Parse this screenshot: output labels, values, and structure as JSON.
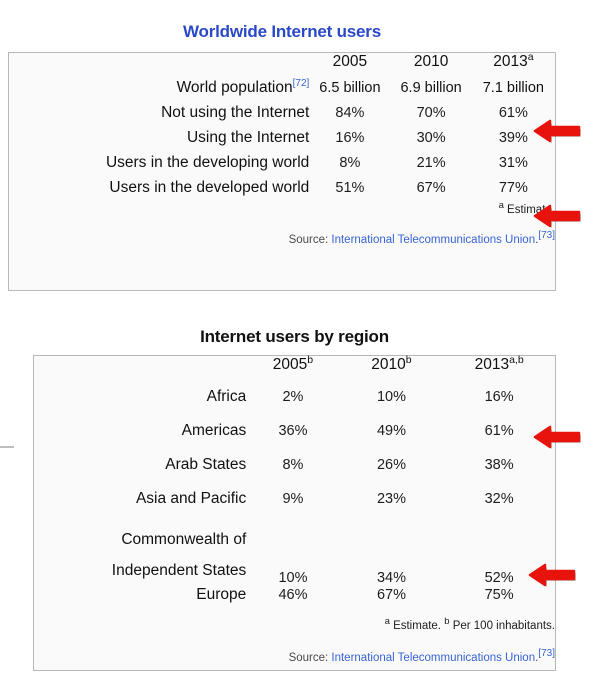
{
  "table1": {
    "title": "Worldwide Internet users",
    "title_color": "#2a49c8",
    "columns": [
      "",
      "2005",
      "2010",
      "2013"
    ],
    "col_2013_note": "a",
    "rows": [
      {
        "label": "World population",
        "label_ref": "[72]",
        "values": [
          "6.5 billion",
          "6.9 billion",
          "7.1 billion"
        ]
      },
      {
        "label": "Not using the Internet",
        "values": [
          "84%",
          "70%",
          "61%"
        ]
      },
      {
        "label": "Using the Internet",
        "values": [
          "16%",
          "30%",
          "39%"
        ]
      },
      {
        "label": "Users in the developing world",
        "values": [
          "8%",
          "21%",
          "31%"
        ]
      },
      {
        "label": "Users in the developed world",
        "values": [
          "51%",
          "67%",
          "77%"
        ]
      }
    ],
    "footnote_marker": "a",
    "footnote_text": " Estimate.",
    "source_prefix": "Source: ",
    "source_link": "International Telecommunications Union",
    "source_suffix": ".",
    "source_ref": "[73]"
  },
  "table2": {
    "title": "Internet users by region",
    "title_color": "#111111",
    "columns": [
      "",
      "2005",
      "2010",
      "2013"
    ],
    "col_2005_note": "b",
    "col_2010_note": "b",
    "col_2013_note": "a,b",
    "rows": [
      {
        "label": "Africa",
        "values": [
          "2%",
          "10%",
          "16%"
        ]
      },
      {
        "label": "Americas",
        "values": [
          "36%",
          "49%",
          "61%"
        ]
      },
      {
        "label": "Arab States",
        "values": [
          "8%",
          "26%",
          "38%"
        ]
      },
      {
        "label": "Asia and Pacific",
        "values": [
          "9%",
          "23%",
          "32%"
        ]
      },
      {
        "label": "Commonwealth of Independent States",
        "values": [
          "10%",
          "34%",
          "52%"
        ]
      },
      {
        "label": "Europe",
        "values": [
          "46%",
          "67%",
          "75%"
        ]
      }
    ],
    "footnote_marker_a": "a",
    "footnote_text_a": " Estimate. ",
    "footnote_marker_b": "b",
    "footnote_text_b": " Per 100 inhabitants.",
    "source_prefix": "Source: ",
    "source_link": "International Telecommunications Union",
    "source_suffix": ".",
    "source_ref": "[73]"
  },
  "annotations": {
    "arrow_color": "#e8130d",
    "arrows": [
      {
        "name": "arrow-not-using-internet-2013"
      },
      {
        "name": "arrow-users-developed-world-2013"
      },
      {
        "name": "arrow-americas-2013"
      },
      {
        "name": "arrow-europe-2013"
      }
    ]
  }
}
